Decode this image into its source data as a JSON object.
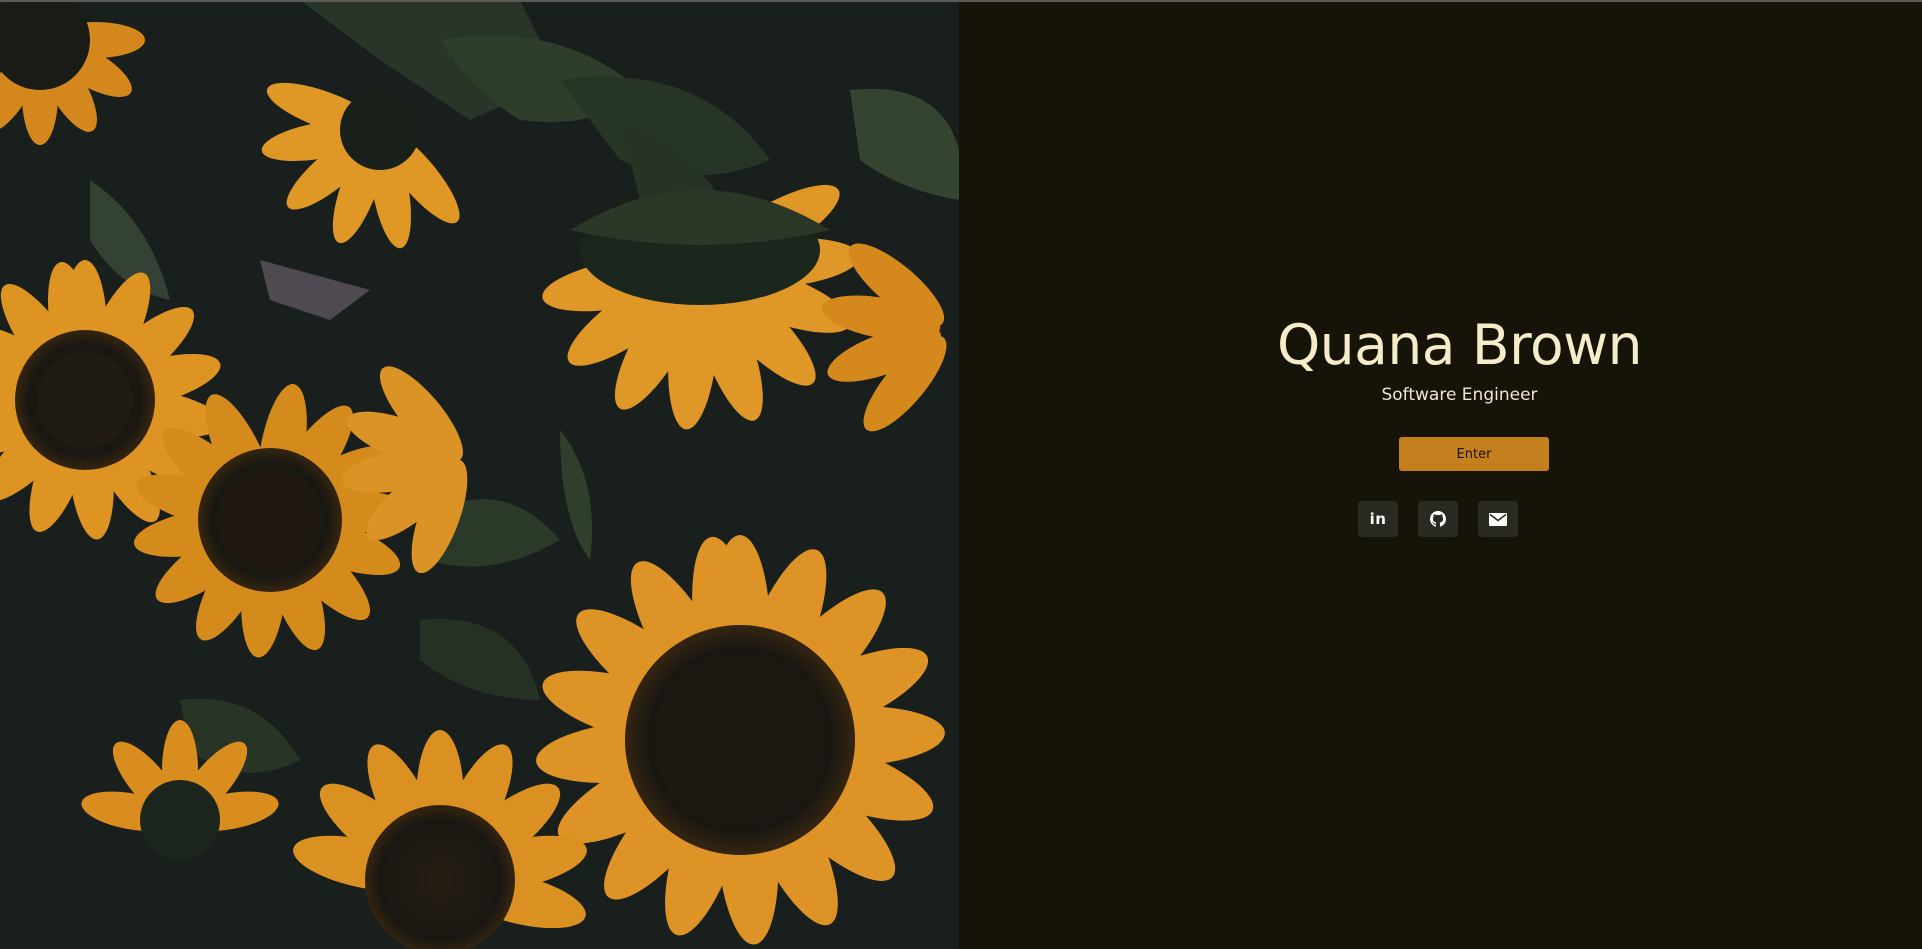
{
  "profile": {
    "name": "Quana Brown",
    "title": "Software Engineer"
  },
  "actions": {
    "enter_label": "Enter"
  },
  "socials": [
    {
      "label": "in",
      "icon": "linkedin-icon"
    },
    {
      "icon": "github-icon"
    },
    {
      "icon": "email-icon"
    }
  ],
  "colors": {
    "background": "#161409",
    "accent": "#c4801f",
    "name_text": "#f5ecc9",
    "icon_tile": "#2b2a22"
  },
  "hero_image": {
    "subject": "sunflowers"
  }
}
